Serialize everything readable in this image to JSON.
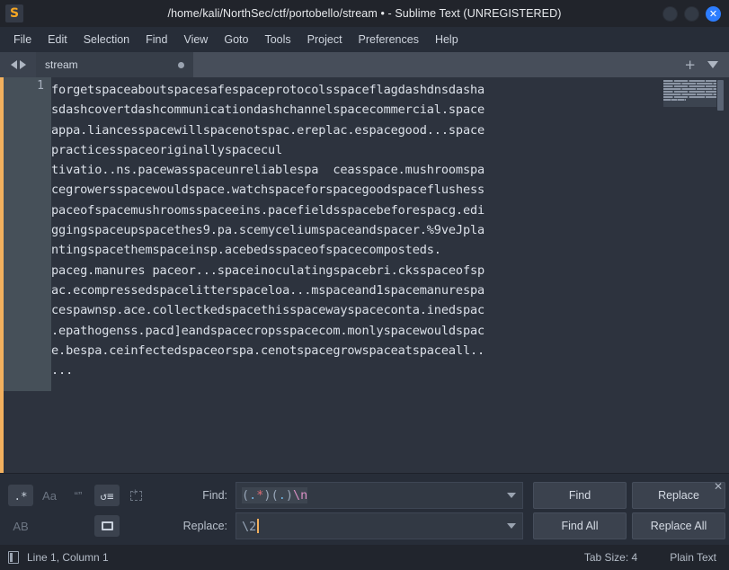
{
  "window": {
    "title": "/home/kali/NorthSec/ctf/portobello/stream • - Sublime Text (UNREGISTERED)",
    "logo_glyph": "S",
    "close_glyph": "✕"
  },
  "menubar": {
    "items": [
      {
        "label": "File"
      },
      {
        "label": "Edit"
      },
      {
        "label": "Selection"
      },
      {
        "label": "Find"
      },
      {
        "label": "View"
      },
      {
        "label": "Goto"
      },
      {
        "label": "Tools"
      },
      {
        "label": "Project"
      },
      {
        "label": "Preferences"
      },
      {
        "label": "Help"
      }
    ]
  },
  "tabbar": {
    "tabs": [
      {
        "label": "stream",
        "dirty": true
      }
    ],
    "new_tab_glyph": "+"
  },
  "editor": {
    "line_number": "1",
    "lines": [
      "forgetspaceaboutspacesafespaceprotocolsspaceflagdashdnsdasha",
      "sdashcovertdashcommunicationdashchannelspacecommercial.space",
      "appa.liancesspacewillspacenotspac.ereplac.espacegood...space",
      "practicesspaceoriginallyspacecul",
      "tivatio..ns.pacewasspaceunreliablespa  ceasspace.mushroomspa",
      "cegrowersspacewouldspace.watchspaceforspacegoodspaceflushess",
      "paceofspacemushroomsspaceeins.pacefieldsspacebeforespacg.edi",
      "ggingspaceupspacethes9.pa.scemyceliumspaceandspacer.%9veJpla",
      "ntingspacethemspaceinsp.acebedsspaceofspacecomposteds.",
      "paceg.manures paceor...spaceinoculatingspacebri.cksspaceofsp",
      "ac.ecompressedspacelitterspaceloa...mspaceand1spacemanurespa",
      "cespawnsp.ace.collectkedspacethisspacewayspaceconta.inedspac",
      ".epathogenss.pacd]eandspacecropsspacecom.monlyspacewouldspac",
      "e.bespa.ceinfectedspaceorspa.cenotspacegrowspaceatspaceall..",
      "..."
    ]
  },
  "findpanel": {
    "toggles": [
      {
        "name": "regex",
        "label": ".*",
        "active": true
      },
      {
        "name": "case-sensitive",
        "label": "Aa",
        "active": false
      },
      {
        "name": "whole-word",
        "label": "“”",
        "active": false
      },
      {
        "name": "wrap",
        "label": "↺≡",
        "active": true
      },
      {
        "name": "in-selection",
        "label": "",
        "active": false
      },
      {
        "name": "preserve-case",
        "label": "AB",
        "active": false
      },
      {
        "name": "show-context",
        "label": "",
        "active": true
      }
    ],
    "find_label": "Find:",
    "find_value": "(.*)(.)\\n",
    "find_tokens": [
      {
        "t": "(",
        "c": "g"
      },
      {
        "t": ".",
        "c": "b"
      },
      {
        "t": "*",
        "c": "r"
      },
      {
        "t": ")",
        "c": "g"
      },
      {
        "t": "(",
        "c": "g"
      },
      {
        "t": ".",
        "c": "b"
      },
      {
        "t": ")",
        "c": "g"
      },
      {
        "t": "\\n",
        "c": "p"
      }
    ],
    "replace_label": "Replace:",
    "replace_value": "\\2",
    "buttons": {
      "find": "Find",
      "replace": "Replace",
      "find_all": "Find All",
      "replace_all": "Replace All"
    },
    "close_glyph": "✕"
  },
  "statusbar": {
    "position": "Line 1, Column 1",
    "tab_size": "Tab Size: 4",
    "syntax": "Plain Text"
  },
  "colors": {
    "accent_orange": "#f2b05e",
    "close_blue": "#2d7dff",
    "editor_bg": "#2d333e",
    "chrome_bg": "#272d38"
  }
}
